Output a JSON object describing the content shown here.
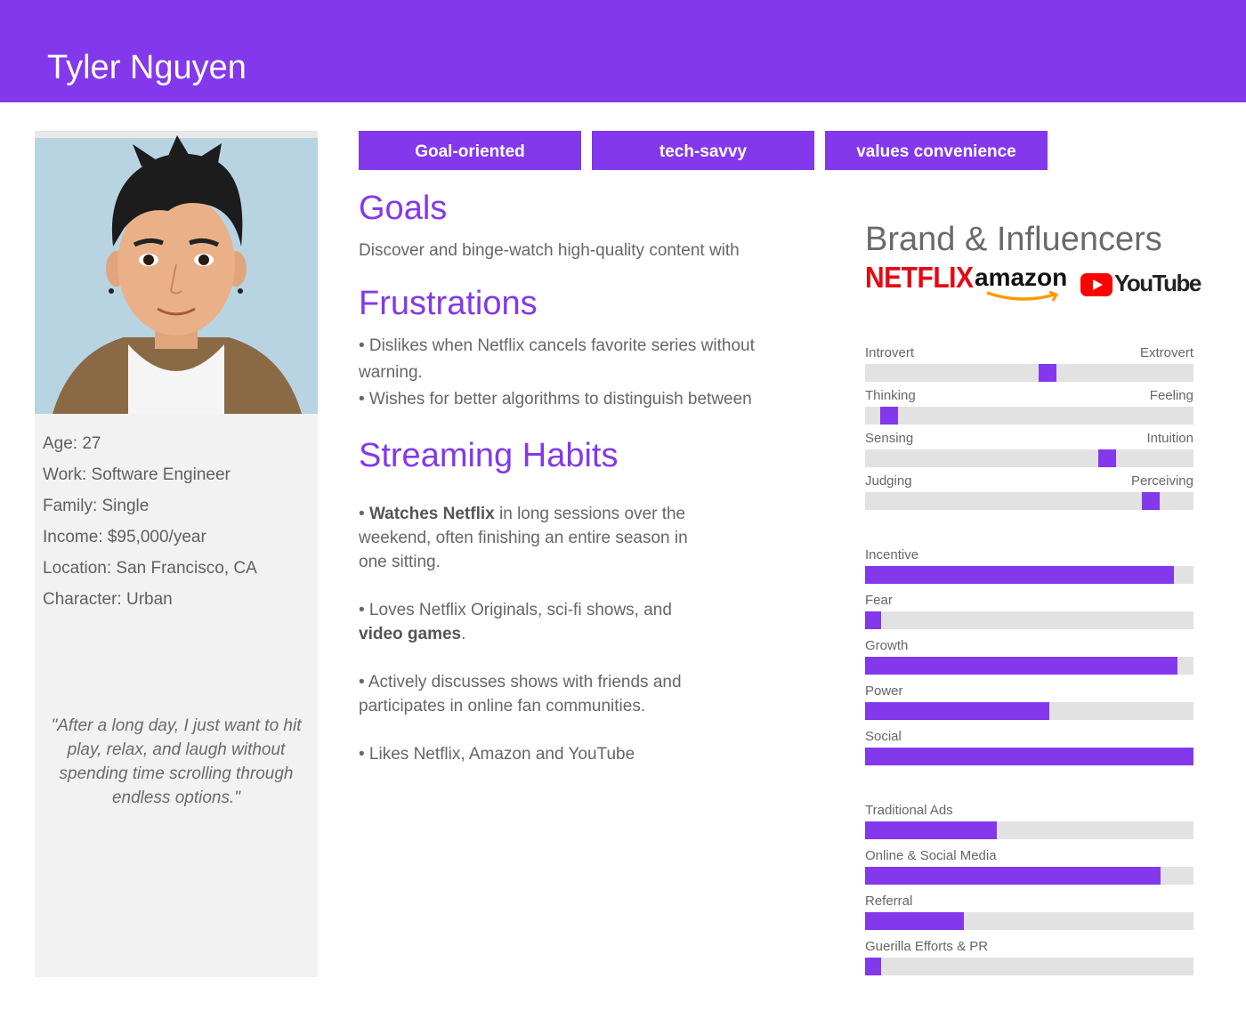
{
  "persona": {
    "name": "Tyler Nguyen",
    "details": [
      "Age: 27",
      "Work: Software Engineer",
      "Family: Single",
      "Income: $95,000/year",
      "Location: San Francisco, CA",
      "Character: Urban"
    ],
    "quote": "\"After a long day, I just want to hit play, relax, and laugh without spending time scrolling through endless options.\""
  },
  "tags": [
    "Goal-oriented",
    "tech-savvy",
    "values convenience"
  ],
  "goals": {
    "heading": "Goals",
    "text": "Discover and binge-watch high-quality content with"
  },
  "frustrations": {
    "heading": "Frustrations",
    "items": [
      "• Dislikes when Netflix cancels favorite series without warning.",
      "• Wishes for better algorithms to distinguish between"
    ]
  },
  "habits": {
    "heading": "Streaming Habits",
    "h1_prefix": "• ",
    "h1_bold": "Watches Netflix",
    "h1_rest": " in long sessions over the weekend, often finishing an entire season in one sitting.",
    "h2_prefix": "• Loves Netflix Originals, sci-fi shows, and ",
    "h2_bold": "video games",
    "h2_rest": ".",
    "h3": "• Actively discusses shows with friends and participates in online fan communities.",
    "h4": "• Likes Netflix, Amazon and YouTube"
  },
  "brands": {
    "heading": "Brand & Influencers",
    "netflix": "NETFLIX",
    "amazon": "amazon",
    "youtube": "YouTube"
  },
  "personality": [
    {
      "left": "Introvert",
      "right": "Extrovert",
      "value": 0.56
    },
    {
      "left": "Thinking",
      "right": "Feeling",
      "value": 0.05
    },
    {
      "left": "Sensing",
      "right": "Intuition",
      "value": 0.75
    },
    {
      "left": "Judging",
      "right": "Perceiving",
      "value": 0.89
    }
  ],
  "motivations": [
    {
      "label": "Incentive",
      "value": 0.94
    },
    {
      "label": "Fear",
      "value": 0.05
    },
    {
      "label": "Growth",
      "value": 0.95
    },
    {
      "label": "Power",
      "value": 0.56
    },
    {
      "label": "Social",
      "value": 1.0
    }
  ],
  "channels": [
    {
      "label": "Traditional Ads",
      "value": 0.4
    },
    {
      "label": "Online & Social Media",
      "value": 0.9
    },
    {
      "label": "Referral",
      "value": 0.3
    },
    {
      "label": "Guerilla Efforts & PR",
      "value": 0.05
    }
  ],
  "colors": {
    "accent": "#8338ec",
    "track": "#e2e2e2",
    "netflix_red": "#e50914",
    "amazon_orange": "#ff9900",
    "youtube_red": "#ff0000"
  }
}
